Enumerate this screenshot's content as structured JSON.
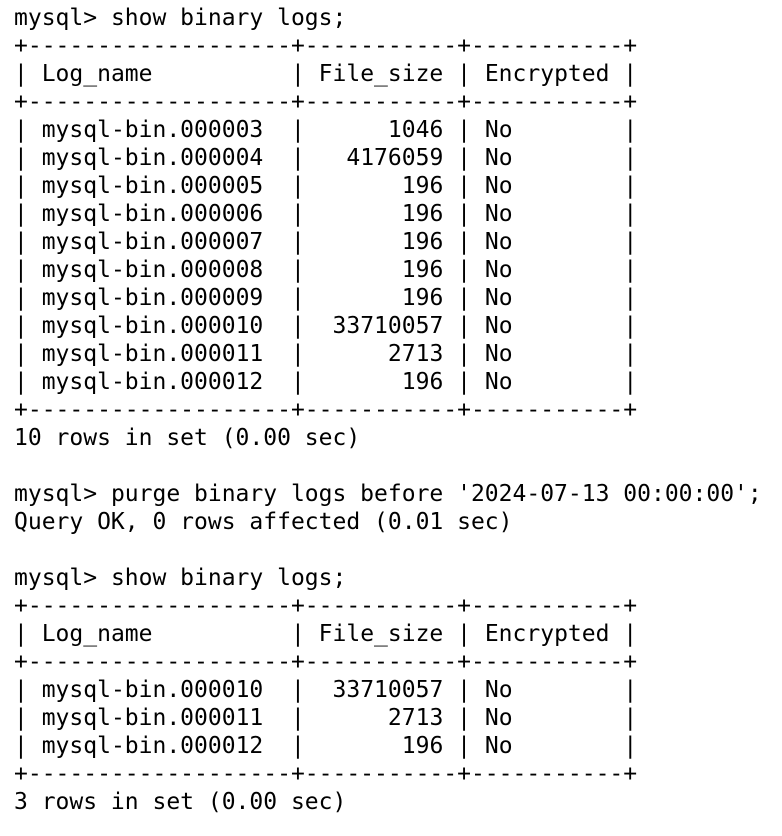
{
  "terminal": {
    "sessions": [
      {
        "prompt": "mysql> ",
        "command": "show binary logs;",
        "table": {
          "border": "+-------------------+-----------+-----------+",
          "columns": [
            "Log_name",
            "File_size",
            "Encrypted"
          ],
          "rows": [
            [
              "mysql-bin.000003",
              "1046",
              "No"
            ],
            [
              "mysql-bin.000004",
              "4176059",
              "No"
            ],
            [
              "mysql-bin.000005",
              "196",
              "No"
            ],
            [
              "mysql-bin.000006",
              "196",
              "No"
            ],
            [
              "mysql-bin.000007",
              "196",
              "No"
            ],
            [
              "mysql-bin.000008",
              "196",
              "No"
            ],
            [
              "mysql-bin.000009",
              "196",
              "No"
            ],
            [
              "mysql-bin.000010",
              "33710057",
              "No"
            ],
            [
              "mysql-bin.000011",
              "2713",
              "No"
            ],
            [
              "mysql-bin.000012",
              "196",
              "No"
            ]
          ]
        },
        "result": "10 rows in set (0.00 sec)"
      },
      {
        "prompt": "mysql> ",
        "command": "purge binary logs before '2024-07-13 00:00:00';",
        "result": "Query OK, 0 rows affected (0.01 sec)"
      },
      {
        "prompt": "mysql> ",
        "command": "show binary logs;",
        "table": {
          "border": "+-------------------+-----------+-----------+",
          "columns": [
            "Log_name",
            "File_size",
            "Encrypted"
          ],
          "rows": [
            [
              "mysql-bin.000010",
              "33710057",
              "No"
            ],
            [
              "mysql-bin.000011",
              "2713",
              "No"
            ],
            [
              "mysql-bin.000012",
              "196",
              "No"
            ]
          ]
        },
        "result": "3 rows in set (0.00 sec)"
      }
    ]
  }
}
